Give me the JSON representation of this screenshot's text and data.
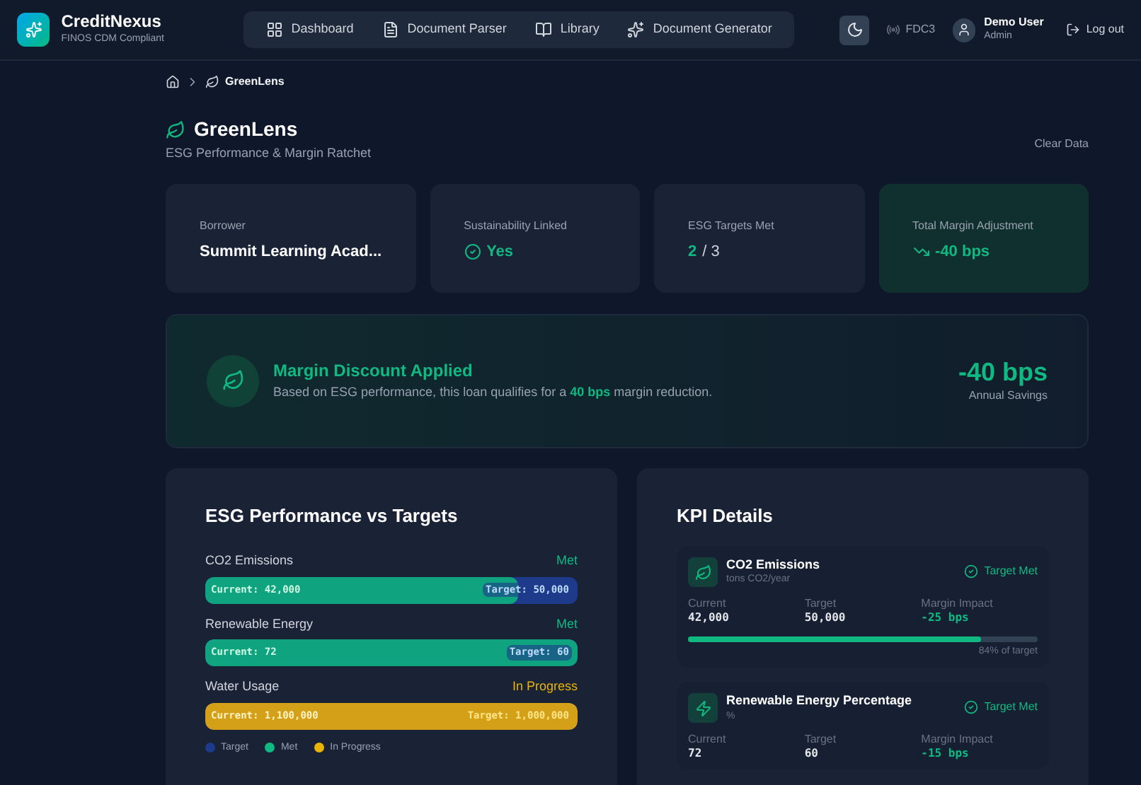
{
  "app": {
    "name": "CreditNexus",
    "subtitle": "FINOS CDM Compliant"
  },
  "nav": [
    {
      "label": "Dashboard",
      "selected": false
    },
    {
      "label": "Document Parser",
      "selected": false
    },
    {
      "label": "Library",
      "selected": false
    },
    {
      "label": "Document Generator",
      "selected": false
    }
  ],
  "header_right": {
    "fdc3": "FDC3",
    "user_name": "Demo User",
    "user_role": "Admin",
    "logout": "Log out"
  },
  "breadcrumb": {
    "current": "GreenLens"
  },
  "page": {
    "title": "GreenLens",
    "subtitle": "ESG Performance & Margin Ratchet",
    "clear": "Clear Data"
  },
  "stats": [
    {
      "label": "Borrower",
      "value": "Summit Learning Acad...",
      "kind": "text"
    },
    {
      "label": "Sustainability Linked",
      "value": "Yes",
      "kind": "check"
    },
    {
      "label": "ESG Targets Met",
      "value": "2",
      "total": "/ 3",
      "kind": "ratio"
    },
    {
      "label": "Total Margin Adjustment",
      "value": "-40 bps",
      "kind": "trend"
    }
  ],
  "banner": {
    "title": "Margin Discount Applied",
    "text": "Based on ESG performance, this loan qualifies for a **40 bps** margin reduction.",
    "amount": "-40 bps",
    "amount_label": "Annual Savings"
  },
  "performance": {
    "title": "ESG Performance vs Targets",
    "bars": [
      {
        "name": "CO2 Emissions",
        "status": "Met",
        "kind": "met",
        "current": "Current: 42,000",
        "target": "Target: 50,000",
        "level": 0.84
      },
      {
        "name": "Renewable Energy",
        "status": "Met",
        "kind": "met",
        "current": "Current: 72",
        "target": "Target: 60",
        "level": 1
      },
      {
        "name": "Water Usage",
        "status": "In Progress",
        "kind": "progress",
        "current": "Current: 1,100,000",
        "target": "Target: 1,000,000",
        "level": 1
      }
    ],
    "legend": [
      {
        "label": "Target",
        "color": "#1e3a8a"
      },
      {
        "label": "Met",
        "color": "#10b981"
      },
      {
        "label": "In Progress",
        "color": "#eab308"
      }
    ]
  },
  "kpi": {
    "title": "KPI Details",
    "items": [
      {
        "name": "CO2 Emissions",
        "unit": "tons CO2/year",
        "status": "Target Met",
        "current_label": "Current",
        "current": "42,000",
        "target_label": "Target",
        "target": "50,000",
        "impact_label": "Margin Impact",
        "impact": "-25 bps",
        "level": 0.84,
        "progress_text": "84% of target"
      },
      {
        "name": "Renewable Energy Percentage",
        "unit": "%",
        "status": "Target Met",
        "current_label": "Current",
        "current": "72",
        "target_label": "Target",
        "target": "60",
        "impact_label": "Margin Impact",
        "impact": "-15 bps"
      }
    ]
  }
}
